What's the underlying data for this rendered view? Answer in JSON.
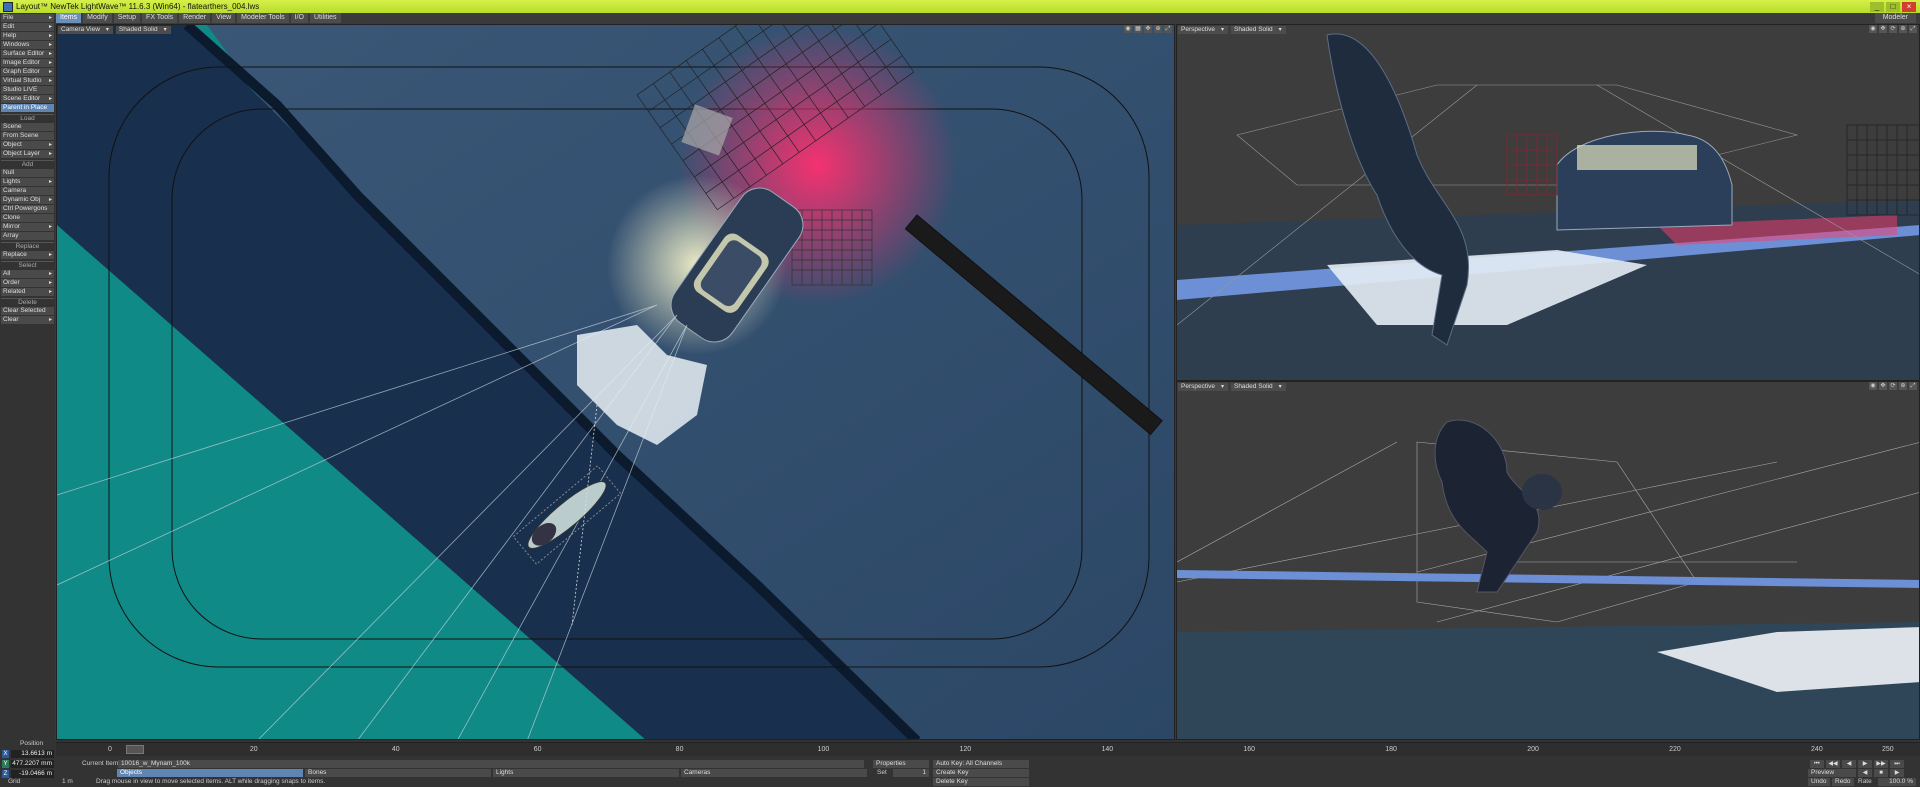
{
  "window": {
    "title": "Layout™ NewTek LightWave™ 11.6.3 (Win64) - flatearthers_004.lws"
  },
  "menu": {
    "tabs": [
      "Items",
      "Modify",
      "Setup",
      "FX Tools",
      "Render",
      "View",
      "Modeler Tools",
      "I/O",
      "Utilities"
    ],
    "active": 0,
    "modeler": "Modeler"
  },
  "sidebar": {
    "top": [
      {
        "label": "File",
        "arrow": true
      },
      {
        "label": "Edit",
        "arrow": true
      },
      {
        "label": "Help",
        "arrow": true
      },
      {
        "label": "Windows",
        "arrow": true
      },
      {
        "label": "Surface Editor",
        "arrow": true
      },
      {
        "label": "Image Editor",
        "arrow": true
      },
      {
        "label": "Graph Editor",
        "arrow": true
      },
      {
        "label": "Virtual Studio",
        "arrow": true
      },
      {
        "label": "Studio LIVE",
        "arrow": false
      },
      {
        "label": "Scene Editor",
        "arrow": true
      },
      {
        "label": "Parent in Place",
        "arrow": false,
        "active": true
      }
    ],
    "load_head": "Load",
    "load": [
      {
        "label": "Scene",
        "arrow": false
      },
      {
        "label": "From Scene",
        "arrow": false
      },
      {
        "label": "Object",
        "arrow": true
      },
      {
        "label": "Object Layer",
        "arrow": true
      }
    ],
    "add_head": "Add",
    "add": [
      {
        "label": "Null",
        "arrow": false
      },
      {
        "label": "Lights",
        "arrow": true
      },
      {
        "label": "Camera",
        "arrow": false
      },
      {
        "label": "Dynamic Obj",
        "arrow": true
      },
      {
        "label": "Ctrl Powergons",
        "arrow": false
      },
      {
        "label": "Clone",
        "arrow": false
      },
      {
        "label": "Mirror",
        "arrow": true
      },
      {
        "label": "Array",
        "arrow": false
      }
    ],
    "replace_head": "Replace",
    "replace": [
      {
        "label": "Replace",
        "arrow": true
      }
    ],
    "select_head": "Select",
    "select": [
      {
        "label": "All",
        "arrow": true
      },
      {
        "label": "Order",
        "arrow": true
      },
      {
        "label": "Related",
        "arrow": true
      }
    ],
    "delete_head": "Delete",
    "delete": [
      {
        "label": "Clear Selected",
        "arrow": false
      },
      {
        "label": "Clear",
        "arrow": true
      }
    ]
  },
  "viewports": {
    "main": {
      "view": "Camera View",
      "shading": "Shaded Solid"
    },
    "top_right": {
      "view": "Perspective",
      "shading": "Shaded Solid"
    },
    "bottom_right": {
      "view": "Perspective",
      "shading": "Shaded Solid"
    }
  },
  "timeline": {
    "ticks": [
      "0",
      "20",
      "40",
      "60",
      "80",
      "100",
      "120",
      "140",
      "160",
      "180",
      "200",
      "220",
      "240",
      "250"
    ],
    "current_frame": 0.5,
    "range": [
      0,
      250
    ]
  },
  "position": {
    "label": "Position",
    "x": {
      "axis": "X",
      "value": "13.6613 m"
    },
    "y": {
      "axis": "Y",
      "value": "477.2207 mm"
    },
    "z": {
      "axis": "Z",
      "value": "-19.0466 m"
    },
    "grid_label": "Grid",
    "grid_value": "1 m"
  },
  "bottom": {
    "current_item_label": "Current Item",
    "current_item": "10016_w_Mynam_100k",
    "properties": "Properties",
    "categories": [
      "Objects",
      "Bones",
      "Lights",
      "Cameras"
    ],
    "set_label": "Set",
    "set_value": "1",
    "auto_key": "Auto Key: All Channels",
    "create_key": "Create Key",
    "delete_key": "Delete Key",
    "preview": "Preview",
    "undo": "Undo",
    "redo": "Redo",
    "rate_label": "Rate",
    "rate_value": "100.0 %",
    "status": "Drag mouse in view to move selected items. ALT while dragging snaps to items."
  },
  "colors": {
    "accent": "#b8dc2a",
    "active_blue": "#5f86b3",
    "viewport_bg": "#2f4a66",
    "teal": "#0f8a86"
  }
}
